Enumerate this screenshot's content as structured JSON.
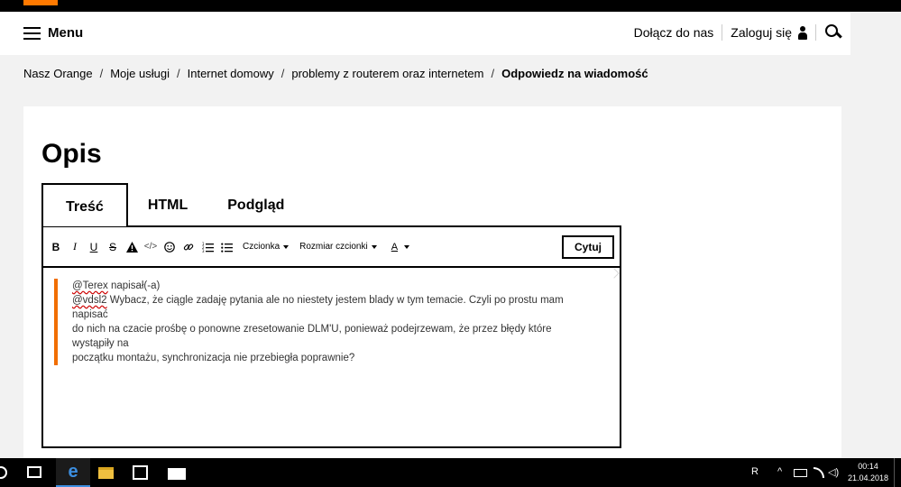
{
  "header": {
    "menu_label": "Menu",
    "join_label": "Dołącz do nas",
    "login_label": "Zaloguj się"
  },
  "breadcrumb": {
    "items": [
      "Nasz Orange",
      "Moje usługi",
      "Internet domowy",
      "problemy z routerem oraz internetem"
    ],
    "current": "Odpowiedz na wiadomość"
  },
  "page": {
    "title": "Opis",
    "tabs": [
      "Treść",
      "HTML",
      "Podgląd"
    ]
  },
  "toolbar": {
    "bold": "B",
    "italic": "I",
    "underline": "U",
    "strike": "S",
    "code": "</>",
    "font_label": "Czcionka",
    "font_size_label": "Rozmiar czcionki",
    "color_label": "A",
    "quote_button": "Cytuj"
  },
  "editor": {
    "quote_author": "@Terex",
    "quote_wrote": " napisał(-a)",
    "reply_mention": "@vdsl2",
    "reply_line1": " Wybacz, że ciągle zadaję pytania ale no niestety jestem blady w tym temacie. Czyli po prostu mam napisać",
    "reply_line2": "do nich na czacie prośbę o ponowne zresetowanie DLM'U, ponieważ podejrzewam, że przez błędy które wystąpiły na",
    "reply_line3": "początku montażu, synchronizacja nie przebiegła poprawnie?"
  },
  "taskbar": {
    "time": "00:14",
    "date": "21.04.2018",
    "tray_user": "R",
    "tray_arrow": "^",
    "tray_volume": "◁)"
  },
  "colors": {
    "accent": "#ff7900",
    "quote_bar": "#f16e00"
  }
}
